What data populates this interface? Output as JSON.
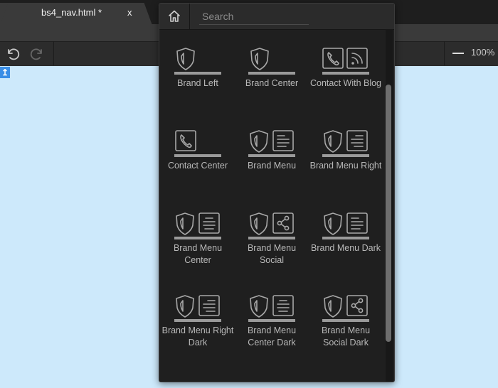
{
  "tab": {
    "title": "bs4_nav.html *",
    "close": "x"
  },
  "toolbar": {
    "zoom": "100%"
  },
  "marker": "↥",
  "search": {
    "placeholder": "Search"
  },
  "tiles": [
    {
      "label": "Brand Left",
      "icons": [
        "shield"
      ]
    },
    {
      "label": "Brand Center",
      "icons": [
        "shield"
      ]
    },
    {
      "label": "Contact With Blog",
      "icons": [
        "phone",
        "rss"
      ]
    },
    {
      "label": "Contact Center",
      "icons": [
        "phone"
      ]
    },
    {
      "label": "Brand Menu",
      "icons": [
        "shield",
        "menu-left"
      ]
    },
    {
      "label": "Brand Menu Right",
      "icons": [
        "shield",
        "menu-right"
      ]
    },
    {
      "label": "Brand Menu Center",
      "icons": [
        "shield",
        "menu-center"
      ]
    },
    {
      "label": "Brand Menu Social",
      "icons": [
        "shield",
        "share"
      ]
    },
    {
      "label": "Brand Menu Dark",
      "icons": [
        "shield",
        "menu-left"
      ]
    },
    {
      "label": "Brand Menu Right Dark",
      "icons": [
        "shield",
        "menu-right"
      ]
    },
    {
      "label": "Brand Menu Center Dark",
      "icons": [
        "shield",
        "menu-center"
      ]
    },
    {
      "label": "Brand Menu Social Dark",
      "icons": [
        "shield",
        "share"
      ]
    }
  ]
}
